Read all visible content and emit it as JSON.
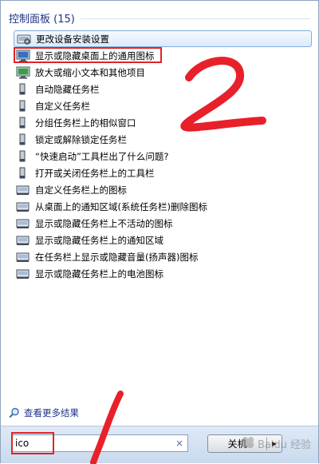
{
  "header": {
    "title": "控制面板 (15)"
  },
  "results": [
    {
      "label": "更改设备安装设置",
      "icon": "device-settings-icon"
    },
    {
      "label": "显示或隐藏桌面上的通用图标",
      "icon": "desktop-monitor-icon"
    },
    {
      "label": "放大或缩小文本和其他项目",
      "icon": "display-monitor-icon"
    },
    {
      "label": "自动隐藏任务栏",
      "icon": "taskbar-icon"
    },
    {
      "label": "自定义任务栏",
      "icon": "taskbar-icon"
    },
    {
      "label": "分组任务栏上的相似窗口",
      "icon": "taskbar-icon"
    },
    {
      "label": "锁定或解除锁定任务栏",
      "icon": "taskbar-icon"
    },
    {
      "label": "“快速启动”工具栏出了什么问题?",
      "icon": "taskbar-icon"
    },
    {
      "label": "打开或关闭任务栏上的工具栏",
      "icon": "taskbar-icon"
    },
    {
      "label": "自定义任务栏上的图标",
      "icon": "notification-area-icon"
    },
    {
      "label": "从桌面上的通知区域(系统任务栏)删除图标",
      "icon": "notification-area-icon"
    },
    {
      "label": "显示或隐藏任务栏上不活动的图标",
      "icon": "notification-area-icon"
    },
    {
      "label": "显示或隐藏任务栏上的通知区域",
      "icon": "notification-area-icon"
    },
    {
      "label": "在任务栏上显示或隐藏音量(扬声器)图标",
      "icon": "notification-area-icon"
    },
    {
      "label": "显示或隐藏任务栏上的电池图标",
      "icon": "notification-area-icon"
    }
  ],
  "more_results": {
    "label": "查看更多结果"
  },
  "search": {
    "value": "ico",
    "clear": "×"
  },
  "shutdown": {
    "label": "关机",
    "arrow": "▶"
  },
  "annotations": {
    "mark_1": "1",
    "mark_2": "2",
    "color": "#e8202a"
  },
  "watermark": {
    "text": "Baidu 经验"
  },
  "colors": {
    "header_text": "#1e3287",
    "selection_border": "#84acdd",
    "bottom_bar": "#d4e2f2"
  }
}
